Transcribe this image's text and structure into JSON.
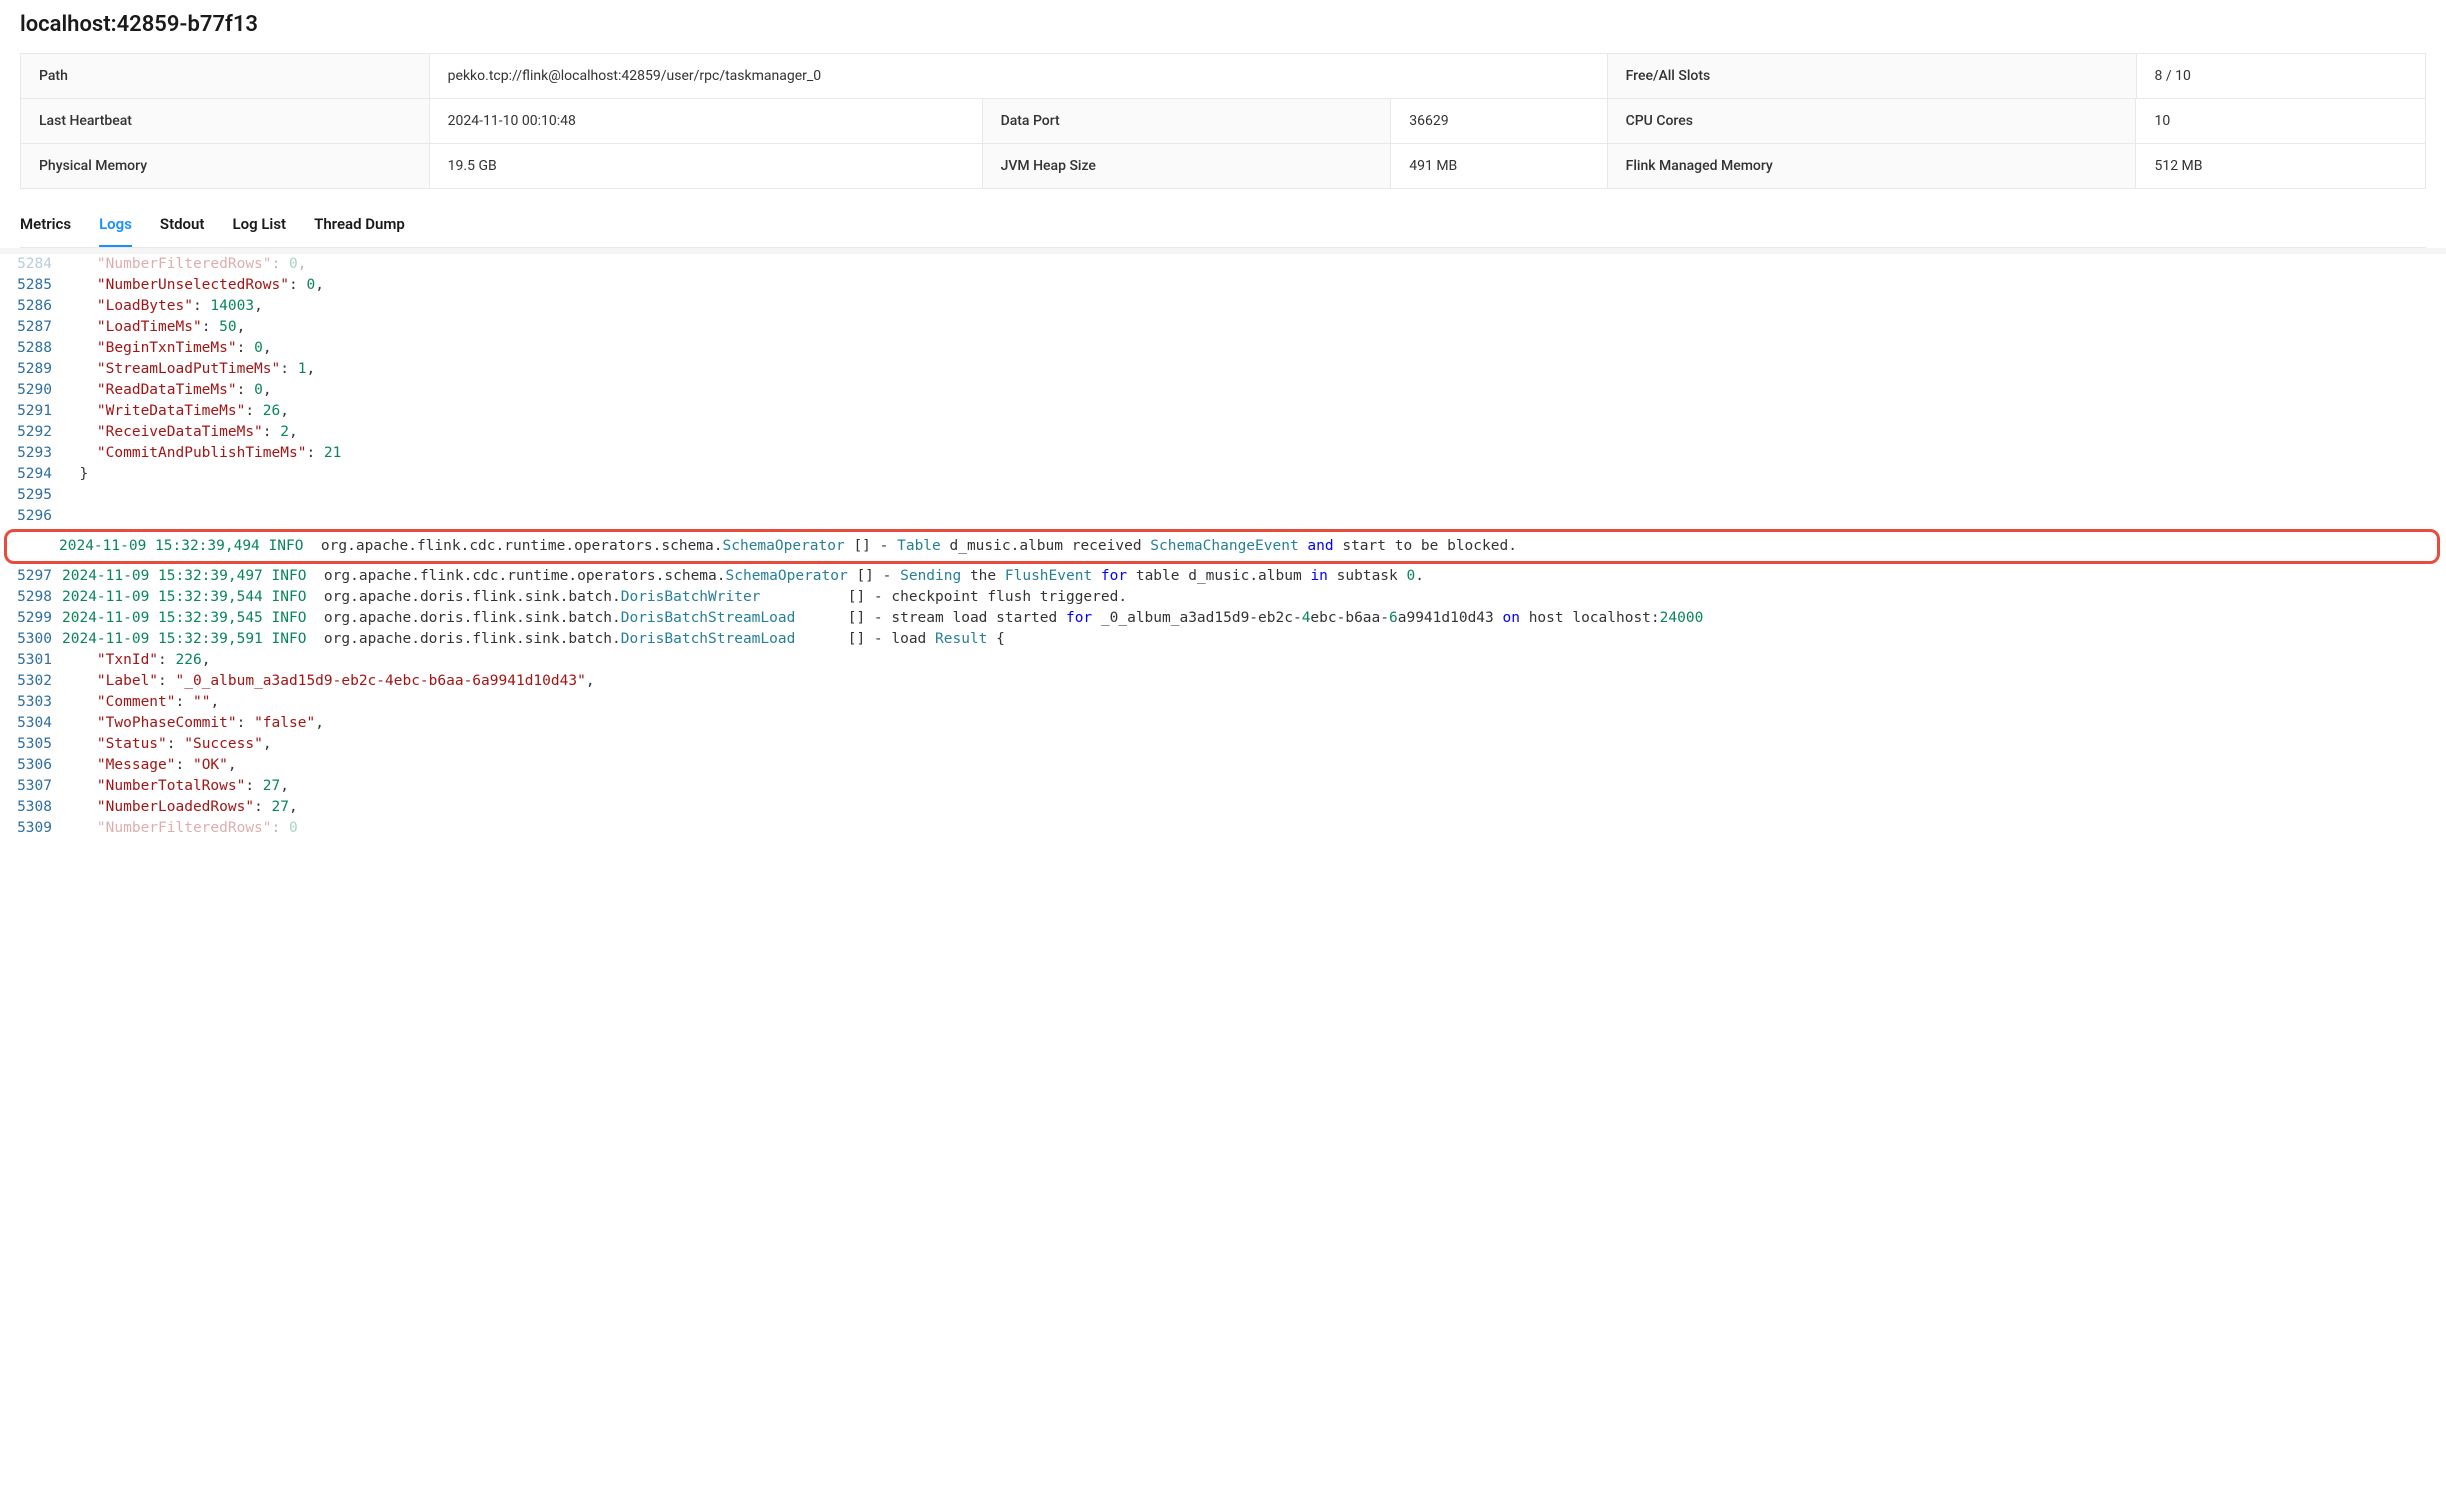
{
  "title": "localhost:42859-b77f13",
  "info": {
    "path_label": "Path",
    "path_value": "pekko.tcp://flink@localhost:42859/user/rpc/taskmanager_0",
    "slots_label": "Free/All Slots",
    "slots_value": "8 / 10",
    "heartbeat_label": "Last Heartbeat",
    "heartbeat_value": "2024-11-10 00:10:48",
    "dataport_label": "Data Port",
    "dataport_value": "36629",
    "cpu_label": "CPU Cores",
    "cpu_value": "10",
    "physmem_label": "Physical Memory",
    "physmem_value": "19.5 GB",
    "jvmheap_label": "JVM Heap Size",
    "jvmheap_value": "491 MB",
    "flinkmem_label": "Flink Managed Memory",
    "flinkmem_value": "512 MB"
  },
  "tabs": {
    "metrics": "Metrics",
    "logs": "Logs",
    "stdout": "Stdout",
    "loglist": "Log List",
    "threaddump": "Thread Dump"
  },
  "log_lines": {
    "l5284": {
      "key": "\"NumberFilteredRows\"",
      "val": "0"
    },
    "l5285": {
      "key": "\"NumberUnselectedRows\"",
      "val": "0"
    },
    "l5286": {
      "key": "\"LoadBytes\"",
      "val": "14003"
    },
    "l5287": {
      "key": "\"LoadTimeMs\"",
      "val": "50"
    },
    "l5288": {
      "key": "\"BeginTxnTimeMs\"",
      "val": "0"
    },
    "l5289": {
      "key": "\"StreamLoadPutTimeMs\"",
      "val": "1"
    },
    "l5290": {
      "key": "\"ReadDataTimeMs\"",
      "val": "0"
    },
    "l5291": {
      "key": "\"WriteDataTimeMs\"",
      "val": "26"
    },
    "l5292": {
      "key": "\"ReceiveDataTimeMs\"",
      "val": "2"
    },
    "l5293": {
      "key": "\"CommitAndPublishTimeMs\"",
      "val": "21"
    },
    "l5294": {
      "text": "  }"
    },
    "l5295": {
      "text": ""
    },
    "l5296": {
      "ts": "2024-11-09 15:32:39,494",
      "level": "INFO",
      "pkg": "org.apache.flink.cdc.runtime.operators.schema.",
      "cls": "SchemaOperator",
      "mid1": " [] - ",
      "id1": "Table",
      "mid2": " d_music.album received ",
      "id2": "SchemaChangeEvent",
      "kw": " and ",
      "tail": "start to be blocked."
    },
    "l5297": {
      "ts": "2024-11-09 15:32:39,497",
      "level": "INFO",
      "pkg": "org.apache.flink.cdc.runtime.operators.schema.",
      "cls": "SchemaOperator",
      "mid1": " [] - ",
      "id1": "Sending",
      "mid2": " the ",
      "id2": "FlushEvent",
      "kw": " for ",
      "mid3": "table d_music.album ",
      "kw2": "in",
      "tail": " subtask ",
      "num": "0",
      "tail2": "."
    },
    "l5298": {
      "ts": "2024-11-09 15:32:39,544",
      "level": "INFO",
      "pkg": "org.apache.doris.flink.sink.batch.",
      "cls": "DorisBatchWriter",
      "tail": "          [] - checkpoint flush triggered."
    },
    "l5299": {
      "ts": "2024-11-09 15:32:39,545",
      "level": "INFO",
      "pkg": "org.apache.doris.flink.sink.batch.",
      "cls": "DorisBatchStreamLoad",
      "mid1": "      [] - stream load started ",
      "kw": "for",
      "cont": " _0_album_a3ad15d9-eb2c-",
      "num1": "4",
      "cont2": "ebc-b6aa-",
      "num2": "6",
      "cont3": "a9941d10d43 ",
      "kw2": "on",
      "cont4": " host localhost:",
      "num3": "24000"
    },
    "l5300": {
      "ts": "2024-11-09 15:32:39,591",
      "level": "INFO",
      "pkg": "org.apache.doris.flink.sink.batch.",
      "cls": "DorisBatchStreamLoad",
      "mid1": "      [] - load ",
      "id1": "Result",
      "tail": " {"
    },
    "l5301": {
      "key": "\"TxnId\"",
      "val": "226"
    },
    "l5302": {
      "key": "\"Label\"",
      "sval": "\"_0_album_a3ad15d9-eb2c-4ebc-b6aa-6a9941d10d43\""
    },
    "l5303": {
      "key": "\"Comment\"",
      "sval": "\"\""
    },
    "l5304": {
      "key": "\"TwoPhaseCommit\"",
      "sval": "\"false\""
    },
    "l5305": {
      "key": "\"Status\"",
      "sval": "\"Success\""
    },
    "l5306": {
      "key": "\"Message\"",
      "sval": "\"OK\""
    },
    "l5307": {
      "key": "\"NumberTotalRows\"",
      "val": "27"
    },
    "l5308": {
      "key": "\"NumberLoadedRows\"",
      "val": "27"
    },
    "l5309": {
      "key": "\"NumberFilteredRows\"",
      "val": "0"
    }
  },
  "gutters": {
    "g5284": "5284",
    "g5285": "5285",
    "g5286": "5286",
    "g5287": "5287",
    "g5288": "5288",
    "g5289": "5289",
    "g5290": "5290",
    "g5291": "5291",
    "g5292": "5292",
    "g5293": "5293",
    "g5294": "5294",
    "g5295": "5295",
    "g5296": "5296",
    "g5297": "5297",
    "g5298": "5298",
    "g5299": "5299",
    "g5300": "5300",
    "g5301": "5301",
    "g5302": "5302",
    "g5303": "5303",
    "g5304": "5304",
    "g5305": "5305",
    "g5306": "5306",
    "g5307": "5307",
    "g5308": "5308",
    "g5309": "5309"
  }
}
